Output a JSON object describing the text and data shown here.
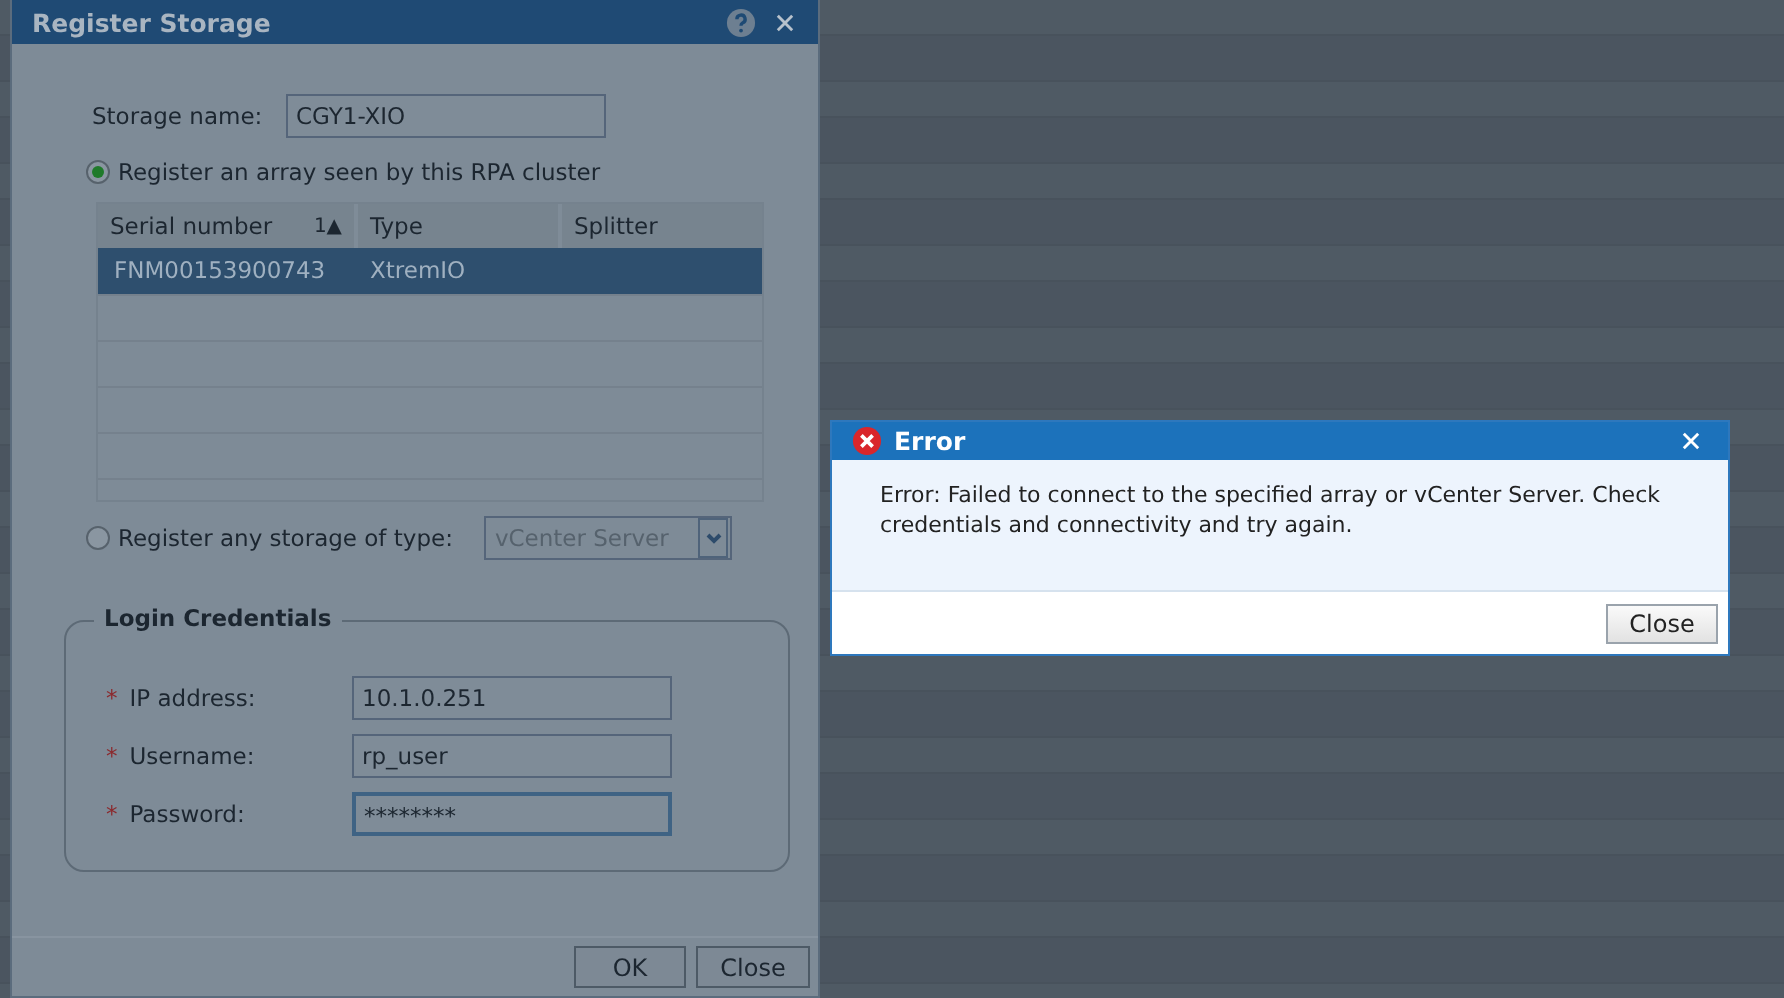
{
  "register_dialog": {
    "title": "Register Storage",
    "storage_name": {
      "label": "Storage name:",
      "value": "CGY1-XIO"
    },
    "options": [
      {
        "kind": "array",
        "label": "Register an array seen by this RPA cluster",
        "selected": true
      },
      {
        "kind": "type",
        "label": "Register any storage of type:",
        "selected": false,
        "value": "vCenter Server"
      }
    ],
    "table": {
      "columns": [
        {
          "label": "Serial number",
          "sort": "1▲"
        },
        {
          "label": "Type"
        },
        {
          "label": "Splitter"
        }
      ],
      "rows": [
        {
          "cells": [
            "FNM00153900743",
            "XtremIO",
            ""
          ],
          "selected": true
        }
      ]
    },
    "credentials": {
      "title": "Login Credentials",
      "fields": [
        {
          "mark": "*",
          "label": "IP address:",
          "value": "10.1.0.251",
          "focused": false
        },
        {
          "mark": "*",
          "label": "Username:",
          "value": "rp_user",
          "focused": false
        },
        {
          "mark": "*",
          "label": "Password:",
          "value": "********",
          "focused": true
        }
      ]
    },
    "buttons": [
      "OK",
      "Close"
    ]
  },
  "error_dialog": {
    "title": "Error",
    "message": "Error: Failed to connect to the specified array or vCenter Server. Check credentials and connectivity and try again.",
    "buttons": [
      "Close"
    ]
  }
}
